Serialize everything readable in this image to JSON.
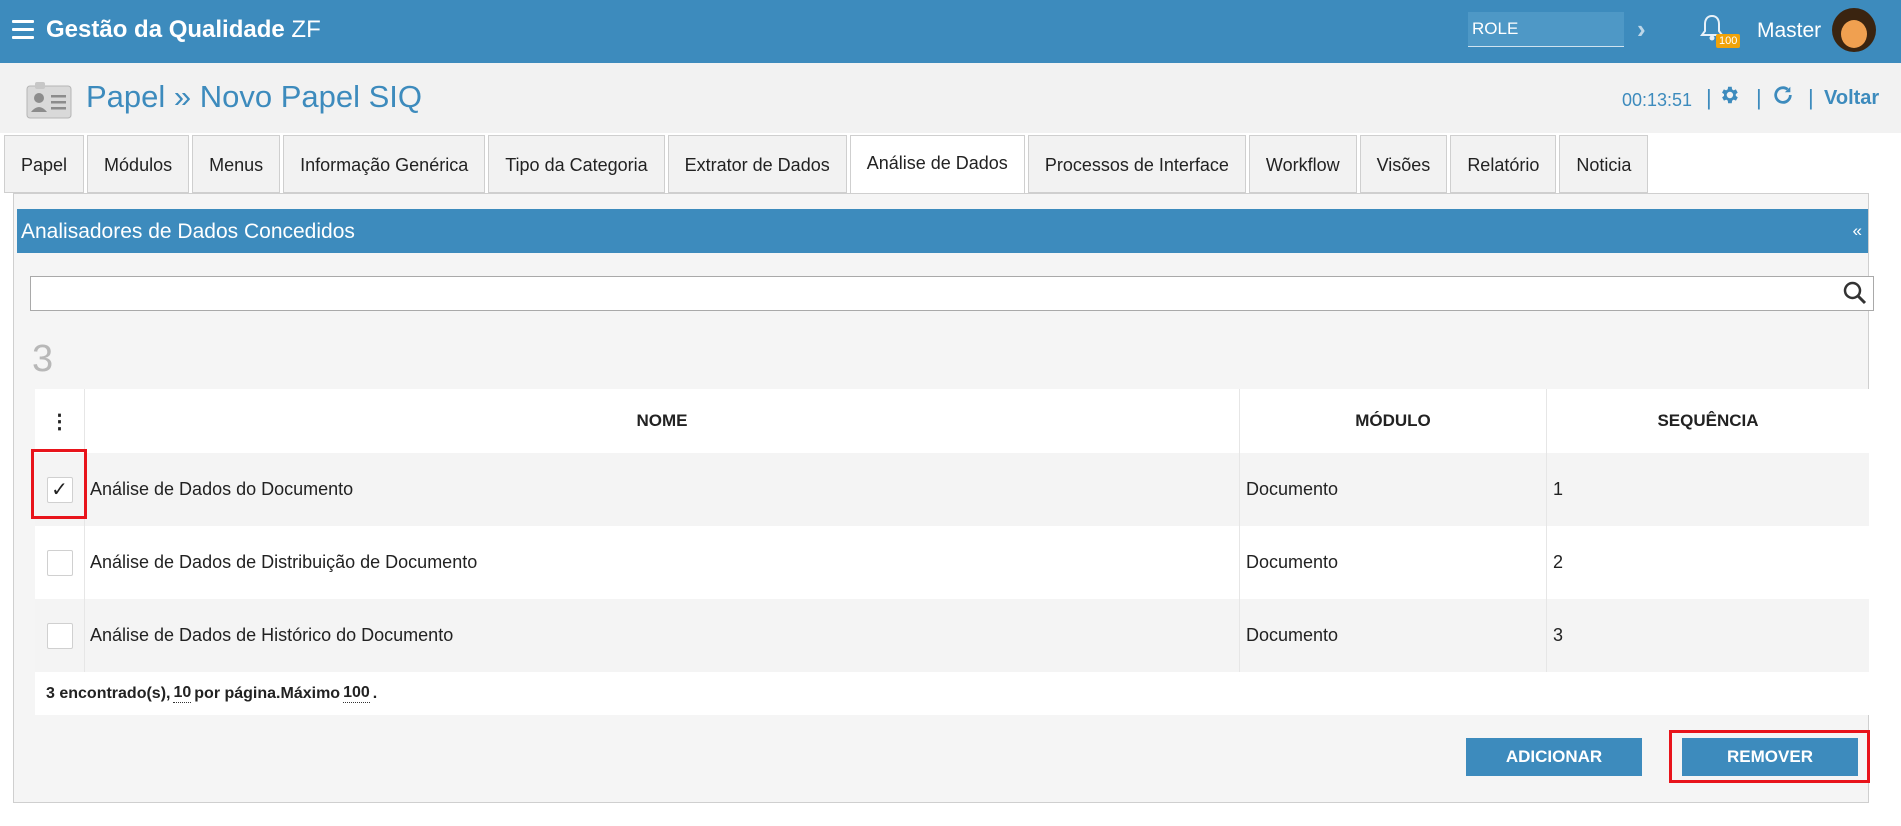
{
  "app": {
    "title_bold": "Gestão da Qualidade",
    "title_suffix": "ZF"
  },
  "topbar": {
    "role_value": "ROLE",
    "notification_count": "100",
    "user_name": "Master"
  },
  "subheader": {
    "title": "Papel » Novo Papel SIQ",
    "timer": "00:13:51",
    "separator": "|",
    "back_label": "Voltar"
  },
  "tabs": [
    {
      "label": "Papel"
    },
    {
      "label": "Módulos"
    },
    {
      "label": "Menus"
    },
    {
      "label": "Informação Genérica"
    },
    {
      "label": "Tipo da Categoria"
    },
    {
      "label": "Extrator de Dados"
    },
    {
      "label": "Análise de Dados",
      "active": true
    },
    {
      "label": "Processos de Interface"
    },
    {
      "label": "Workflow"
    },
    {
      "label": "Visões"
    },
    {
      "label": "Relatório"
    },
    {
      "label": "Noticia"
    }
  ],
  "panel": {
    "title": "Analisadores de Dados Concedidos",
    "collapse_glyph": "«",
    "search_value": "",
    "count": "3"
  },
  "table": {
    "menu_glyph": "⋮",
    "columns": [
      "NOME",
      "MÓDULO",
      "SEQUÊNCIA"
    ],
    "rows": [
      {
        "checked": true,
        "check_glyph": "✓",
        "nome": "Análise de Dados do Documento",
        "modulo": "Documento",
        "sequencia": "1"
      },
      {
        "checked": false,
        "check_glyph": "",
        "nome": "Análise de Dados de Distribuição de Documento",
        "modulo": "Documento",
        "sequencia": "2"
      },
      {
        "checked": false,
        "check_glyph": "",
        "nome": "Análise de Dados de Histórico do Documento",
        "modulo": "Documento",
        "sequencia": "3"
      }
    ],
    "footer": {
      "found": "3 encontrado(s),",
      "per_page": "10",
      "per_page_label": "por página.Máximo",
      "max": "100",
      "end": "."
    }
  },
  "buttons": {
    "add": "ADICIONAR",
    "remove": "REMOVER"
  },
  "colors": {
    "primary": "#3d8bbd",
    "highlight": "#e8141b",
    "badge": "#f0a30a"
  }
}
